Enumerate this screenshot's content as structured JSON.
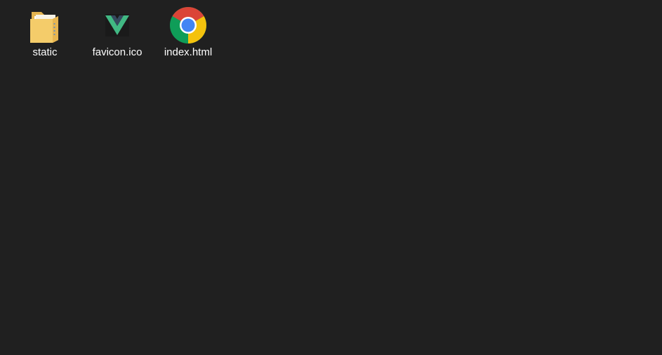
{
  "explorer": {
    "background": "#202020",
    "items": [
      {
        "name": "static",
        "icon": "folder-icon"
      },
      {
        "name": "favicon.ico",
        "icon": "vue-logo-icon"
      },
      {
        "name": "index.html",
        "icon": "chrome-icon"
      }
    ]
  },
  "colors": {
    "folder": "#f4cc6a",
    "vue_green": "#41b883",
    "vue_dark": "#35495e",
    "chrome_red": "#db4437",
    "chrome_yellow": "#f4c20d",
    "chrome_green": "#0f9d58",
    "chrome_blue": "#4285f4"
  }
}
